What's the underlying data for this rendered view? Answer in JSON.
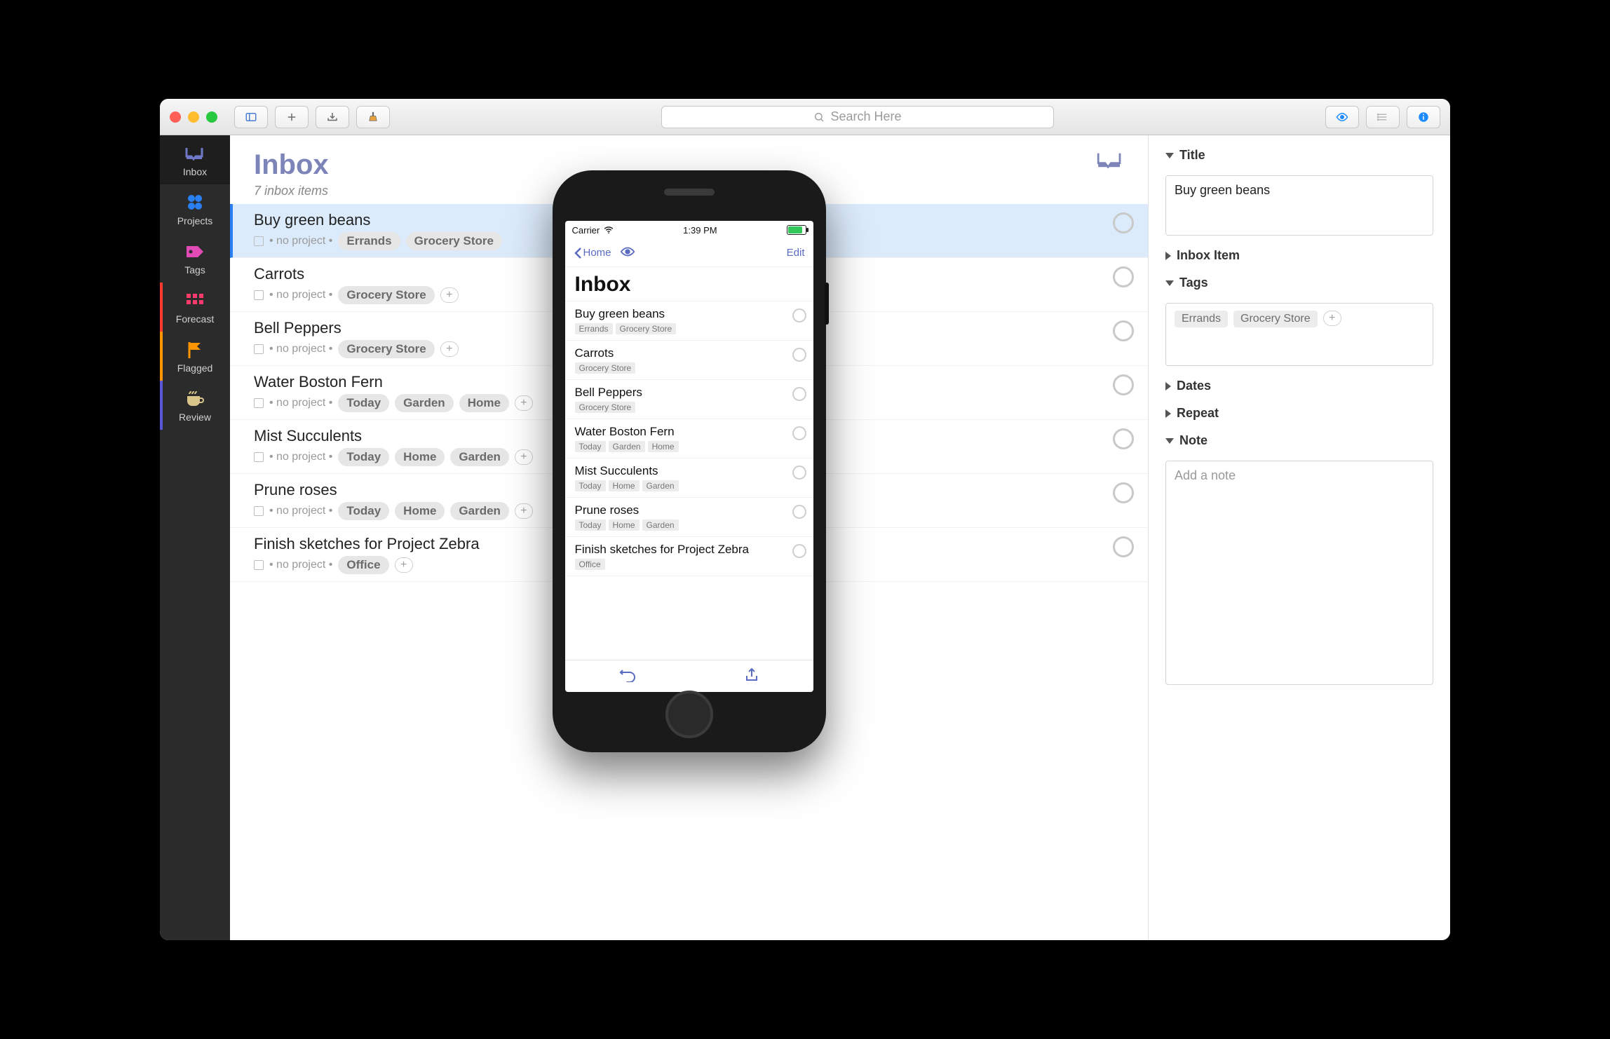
{
  "toolbar": {
    "search_placeholder": "Search Here"
  },
  "sidebar": {
    "items": [
      {
        "label": "Inbox"
      },
      {
        "label": "Projects"
      },
      {
        "label": "Tags"
      },
      {
        "label": "Forecast"
      },
      {
        "label": "Flagged"
      },
      {
        "label": "Review"
      }
    ]
  },
  "main": {
    "title": "Inbox",
    "subtitle": "7 inbox items",
    "no_project": "no project",
    "rows": [
      {
        "title": "Buy green beans",
        "tags": [
          "Errands",
          "Grocery Store"
        ],
        "selected": true,
        "add_tag": false
      },
      {
        "title": "Carrots",
        "tags": [
          "Grocery Store"
        ],
        "add_tag": true
      },
      {
        "title": "Bell Peppers",
        "tags": [
          "Grocery Store"
        ],
        "add_tag": true
      },
      {
        "title": "Water Boston Fern",
        "tags": [
          "Today",
          "Garden",
          "Home"
        ],
        "add_tag": true
      },
      {
        "title": "Mist Succulents",
        "tags": [
          "Today",
          "Home",
          "Garden"
        ],
        "add_tag": true
      },
      {
        "title": " Prune roses",
        "tags": [
          "Today",
          "Home",
          "Garden"
        ],
        "add_tag": true
      },
      {
        "title": "Finish sketches for Project Zebra",
        "tags": [
          "Office"
        ],
        "add_tag": true
      }
    ]
  },
  "inspector": {
    "sections": {
      "title": "Title",
      "inbox_item": "Inbox Item",
      "tags": "Tags",
      "dates": "Dates",
      "repeat": "Repeat",
      "note": "Note"
    },
    "title_value": "Buy green beans",
    "tags": [
      "Errands",
      "Grocery Store"
    ],
    "note_placeholder": "Add a note"
  },
  "phone": {
    "status": {
      "carrier": "Carrier",
      "time": "1:39 PM"
    },
    "nav": {
      "back": "Home",
      "edit": "Edit"
    },
    "title": "Inbox",
    "rows": [
      {
        "title": "Buy green beans",
        "tags": [
          "Errands",
          "Grocery Store"
        ]
      },
      {
        "title": "Carrots",
        "tags": [
          "Grocery Store"
        ]
      },
      {
        "title": "Bell Peppers",
        "tags": [
          "Grocery Store"
        ]
      },
      {
        "title": "Water Boston Fern",
        "tags": [
          "Today",
          "Garden",
          "Home"
        ]
      },
      {
        "title": "Mist Succulents",
        "tags": [
          "Today",
          "Home",
          "Garden"
        ]
      },
      {
        "title": " Prune roses",
        "tags": [
          "Today",
          "Home",
          "Garden"
        ]
      },
      {
        "title": "Finish sketches for Project Zebra",
        "tags": [
          "Office"
        ]
      }
    ]
  }
}
